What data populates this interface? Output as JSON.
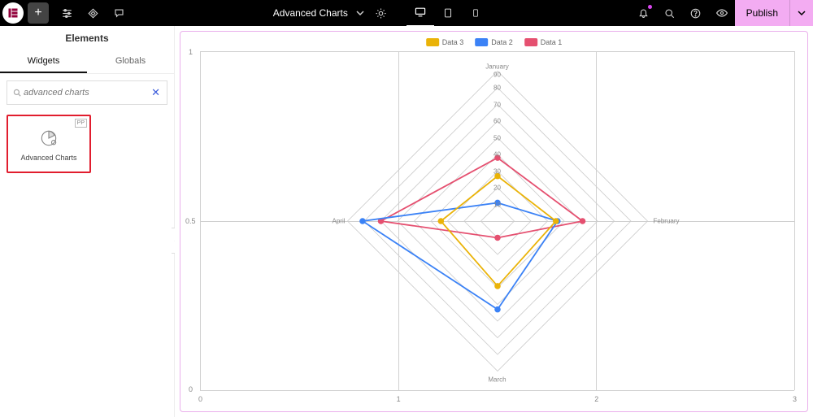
{
  "topbar": {
    "page_name": "Advanced Charts",
    "publish_label": "Publish"
  },
  "sidebar": {
    "panel_title": "Elements",
    "tab_widgets": "Widgets",
    "tab_globals": "Globals",
    "search_value": "advanced charts",
    "widget": {
      "badge": "PP",
      "label": "Advanced Charts"
    }
  },
  "legend": {
    "s1": "Data 3",
    "s2": "Data 2",
    "s3": "Data 1"
  },
  "axis": {
    "y0": "0",
    "y05": "0.5",
    "y1": "1",
    "x0": "0",
    "x1": "1",
    "x2": "2",
    "x3": "3"
  },
  "radar_labels": {
    "top": "January",
    "right": "February",
    "bottom": "March",
    "left": "April",
    "r10": "10",
    "r20": "20",
    "r30": "30",
    "r40": "40",
    "r50": "50",
    "r60": "60",
    "r70": "70",
    "r80": "80",
    "r90": "90"
  },
  "colors": {
    "yellow": "#eab308",
    "blue": "#3b82f6",
    "red": "#e55070"
  },
  "chart_data": {
    "type": "polar-line",
    "categories": [
      "January",
      "February",
      "March",
      "April"
    ],
    "radial_max": 90,
    "radial_ticks": [
      10,
      20,
      30,
      40,
      50,
      60,
      70,
      80,
      90
    ],
    "series": [
      {
        "name": "Data 3",
        "color": "#eab308",
        "values": [
          27,
          35,
          39,
          34
        ]
      },
      {
        "name": "Data 2",
        "color": "#3b82f6",
        "values": [
          11,
          36,
          53,
          81
        ]
      },
      {
        "name": "Data 1",
        "color": "#e55070",
        "values": [
          38,
          51,
          10,
          70
        ]
      }
    ]
  }
}
